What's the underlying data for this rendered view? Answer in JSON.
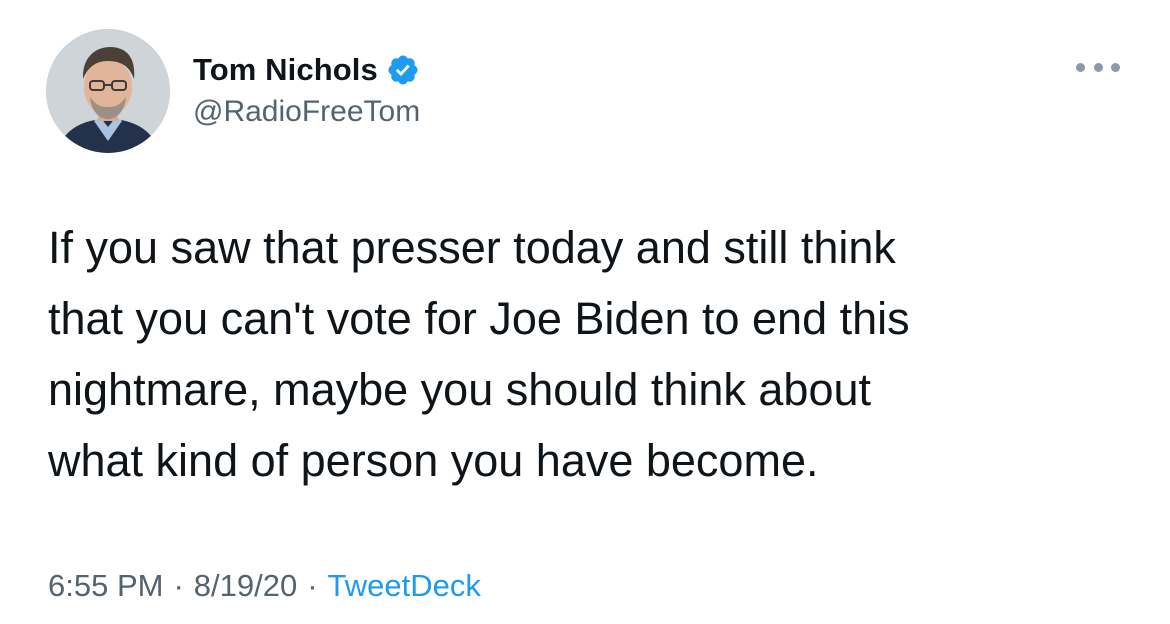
{
  "author": {
    "display_name": "Tom Nichols",
    "handle": "@RadioFreeTom",
    "verified": true
  },
  "tweet": {
    "text_lines": [
      "If you saw that presser today and still think",
      "that you can't vote for Joe Biden to end this",
      "nightmare, maybe you should think about",
      "what kind of person you have become."
    ]
  },
  "meta": {
    "time": "6:55 PM",
    "separator": "·",
    "date": "8/19/20",
    "source": "TweetDeck"
  },
  "icons": {
    "verified": "verified-badge-icon",
    "more": "more-options-icon"
  },
  "colors": {
    "text_primary": "#0f1419",
    "text_secondary": "#536471",
    "accent": "#1d9bf0"
  }
}
